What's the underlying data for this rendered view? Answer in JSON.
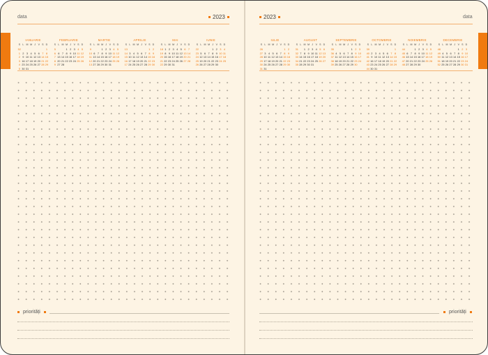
{
  "planner": {
    "year": "2023",
    "date_label": "data",
    "priorities_label": "priorități"
  },
  "weekday_headers": [
    "S",
    "L",
    "M",
    "M",
    "J",
    "V",
    "S",
    "D"
  ],
  "left_months": [
    {
      "name": "IANUARIE",
      "weeks": [
        [
          "52",
          "",
          "",
          "",
          "",
          "",
          "",
          "1"
        ],
        [
          "1",
          "2",
          "3",
          "4",
          "5",
          "6",
          "7",
          "8"
        ],
        [
          "2",
          "9",
          "10",
          "11",
          "12",
          "13",
          "14",
          "15"
        ],
        [
          "3",
          "16",
          "17",
          "18",
          "19",
          "20",
          "21",
          "22"
        ],
        [
          "4",
          "23",
          "24",
          "25",
          "26",
          "27",
          "28",
          "29"
        ],
        [
          "5",
          "30",
          "31",
          "",
          "",
          "",
          "",
          ""
        ]
      ]
    },
    {
      "name": "FEBRUARIE",
      "weeks": [
        [
          "5",
          "",
          "",
          "1",
          "2",
          "3",
          "4",
          "5"
        ],
        [
          "6",
          "6",
          "7",
          "8",
          "9",
          "10",
          "11",
          "12"
        ],
        [
          "7",
          "13",
          "14",
          "15",
          "16",
          "17",
          "18",
          "19"
        ],
        [
          "8",
          "20",
          "21",
          "22",
          "23",
          "24",
          "25",
          "26"
        ],
        [
          "9",
          "27",
          "28",
          "",
          "",
          "",
          "",
          ""
        ]
      ]
    },
    {
      "name": "MARTIE",
      "weeks": [
        [
          "9",
          "",
          "",
          "1",
          "2",
          "3",
          "4",
          "5"
        ],
        [
          "10",
          "6",
          "7",
          "8",
          "9",
          "10",
          "11",
          "12"
        ],
        [
          "11",
          "13",
          "14",
          "15",
          "16",
          "17",
          "18",
          "19"
        ],
        [
          "12",
          "20",
          "21",
          "22",
          "23",
          "24",
          "25",
          "26"
        ],
        [
          "13",
          "27",
          "28",
          "29",
          "30",
          "31",
          "",
          ""
        ]
      ]
    },
    {
      "name": "APRILIE",
      "weeks": [
        [
          "13",
          "",
          "",
          "",
          "",
          "",
          "1",
          "2"
        ],
        [
          "14",
          "3",
          "4",
          "5",
          "6",
          "7",
          "8",
          "9"
        ],
        [
          "15",
          "10",
          "11",
          "12",
          "13",
          "14",
          "15",
          "16"
        ],
        [
          "16",
          "17",
          "18",
          "19",
          "20",
          "21",
          "22",
          "23"
        ],
        [
          "17",
          "24",
          "25",
          "26",
          "27",
          "28",
          "29",
          "30"
        ]
      ]
    },
    {
      "name": "MAI",
      "weeks": [
        [
          "18",
          "1",
          "2",
          "3",
          "4",
          "5",
          "6",
          "7"
        ],
        [
          "19",
          "8",
          "9",
          "10",
          "11",
          "12",
          "13",
          "14"
        ],
        [
          "20",
          "15",
          "16",
          "17",
          "18",
          "19",
          "20",
          "21"
        ],
        [
          "21",
          "22",
          "23",
          "24",
          "25",
          "26",
          "27",
          "28"
        ],
        [
          "22",
          "29",
          "30",
          "31",
          "",
          "",
          "",
          ""
        ]
      ]
    },
    {
      "name": "IUNIE",
      "weeks": [
        [
          "22",
          "",
          "",
          "",
          "1",
          "2",
          "3",
          "4"
        ],
        [
          "23",
          "5",
          "6",
          "7",
          "8",
          "9",
          "10",
          "11"
        ],
        [
          "24",
          "12",
          "13",
          "14",
          "15",
          "16",
          "17",
          "18"
        ],
        [
          "25",
          "19",
          "20",
          "21",
          "22",
          "23",
          "24",
          "25"
        ],
        [
          "26",
          "26",
          "27",
          "28",
          "29",
          "30",
          "",
          ""
        ]
      ]
    }
  ],
  "right_months": [
    {
      "name": "IULIE",
      "weeks": [
        [
          "26",
          "",
          "",
          "",
          "",
          "",
          "1",
          "2"
        ],
        [
          "27",
          "3",
          "4",
          "5",
          "6",
          "7",
          "8",
          "9"
        ],
        [
          "28",
          "10",
          "11",
          "12",
          "13",
          "14",
          "15",
          "16"
        ],
        [
          "29",
          "17",
          "18",
          "19",
          "20",
          "21",
          "22",
          "23"
        ],
        [
          "30",
          "24",
          "25",
          "26",
          "27",
          "28",
          "29",
          "30"
        ],
        [
          "31",
          "31",
          "",
          "",
          "",
          "",
          "",
          ""
        ]
      ]
    },
    {
      "name": "AUGUST",
      "weeks": [
        [
          "31",
          "",
          "1",
          "2",
          "3",
          "4",
          "5",
          "6"
        ],
        [
          "32",
          "7",
          "8",
          "9",
          "10",
          "11",
          "12",
          "13"
        ],
        [
          "33",
          "14",
          "15",
          "16",
          "17",
          "18",
          "19",
          "20"
        ],
        [
          "34",
          "21",
          "22",
          "23",
          "24",
          "25",
          "26",
          "27"
        ],
        [
          "35",
          "28",
          "29",
          "30",
          "31",
          "",
          "",
          ""
        ]
      ]
    },
    {
      "name": "SEPTEMBRIE",
      "weeks": [
        [
          "35",
          "",
          "",
          "",
          "",
          "1",
          "2",
          "3"
        ],
        [
          "36",
          "4",
          "5",
          "6",
          "7",
          "8",
          "9",
          "10"
        ],
        [
          "37",
          "11",
          "12",
          "13",
          "14",
          "15",
          "16",
          "17"
        ],
        [
          "38",
          "18",
          "19",
          "20",
          "21",
          "22",
          "23",
          "24"
        ],
        [
          "39",
          "25",
          "26",
          "27",
          "28",
          "29",
          "30",
          ""
        ]
      ]
    },
    {
      "name": "OCTOMBRIE",
      "weeks": [
        [
          "39",
          "",
          "",
          "",
          "",
          "",
          "",
          "1"
        ],
        [
          "40",
          "2",
          "3",
          "4",
          "5",
          "6",
          "7",
          "8"
        ],
        [
          "41",
          "9",
          "10",
          "11",
          "12",
          "13",
          "14",
          "15"
        ],
        [
          "42",
          "16",
          "17",
          "18",
          "19",
          "20",
          "21",
          "22"
        ],
        [
          "43",
          "23",
          "24",
          "25",
          "26",
          "27",
          "28",
          "29"
        ],
        [
          "44",
          "30",
          "31",
          "",
          "",
          "",
          "",
          ""
        ]
      ]
    },
    {
      "name": "NOIEMBRIE",
      "weeks": [
        [
          "44",
          "",
          "",
          "1",
          "2",
          "3",
          "4",
          "5"
        ],
        [
          "45",
          "6",
          "7",
          "8",
          "9",
          "10",
          "11",
          "12"
        ],
        [
          "46",
          "13",
          "14",
          "15",
          "16",
          "17",
          "18",
          "19"
        ],
        [
          "47",
          "20",
          "21",
          "22",
          "23",
          "24",
          "25",
          "26"
        ],
        [
          "48",
          "27",
          "28",
          "29",
          "30",
          "",
          "",
          ""
        ]
      ]
    },
    {
      "name": "DECEMBRIE",
      "weeks": [
        [
          "48",
          "",
          "",
          "",
          "",
          "1",
          "2",
          "3"
        ],
        [
          "49",
          "4",
          "5",
          "6",
          "7",
          "8",
          "9",
          "10"
        ],
        [
          "50",
          "11",
          "12",
          "13",
          "14",
          "15",
          "16",
          "17"
        ],
        [
          "51",
          "18",
          "19",
          "20",
          "21",
          "22",
          "23",
          "24"
        ],
        [
          "52",
          "25",
          "26",
          "27",
          "28",
          "29",
          "30",
          "31"
        ]
      ]
    }
  ],
  "colors": {
    "accent": "#f07a10",
    "paper": "#fdf4e4",
    "dot": "#9c958a"
  }
}
